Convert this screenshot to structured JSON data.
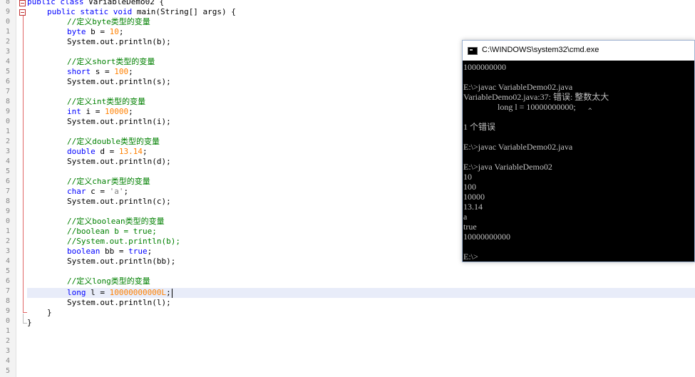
{
  "line_numbers": [
    "8",
    "9",
    "0",
    "1",
    "2",
    "3",
    "4",
    "5",
    "6",
    "7",
    "8",
    "9",
    "0",
    "1",
    "2",
    "3",
    "4",
    "5",
    "6",
    "7",
    "8",
    "9",
    "0",
    "1",
    "2",
    "3",
    "4",
    "5",
    "6",
    "7",
    "8",
    "9",
    "0",
    "1",
    "2",
    "3",
    "4",
    "5"
  ],
  "code": {
    "class_decl": {
      "kw": "public class",
      "rest": " VariableDemo02 {"
    },
    "main_decl": {
      "kw": "public static void",
      "rest": " main(String[] args) {"
    },
    "byte_comment": "//定义byte类型的变量",
    "byte_decl": {
      "kw": "byte",
      "mid": " b = ",
      "num": "10",
      "end": ";"
    },
    "byte_print": "System.out.println(b);",
    "short_comment": "//定义short类型的变量",
    "short_decl": {
      "kw": "short",
      "mid": " s = ",
      "num": "100",
      "end": ";"
    },
    "short_print": "System.out.println(s);",
    "int_comment": "//定义int类型的变量",
    "int_decl": {
      "kw": "int",
      "mid": " i = ",
      "num": "10000",
      "end": ";"
    },
    "int_print": "System.out.println(i);",
    "double_comment": "//定义double类型的变量",
    "double_decl": {
      "kw": "double",
      "mid": " d = ",
      "num": "13.14",
      "end": ";"
    },
    "double_print": "System.out.println(d);",
    "char_comment": "//定义char类型的变量",
    "char_decl": {
      "kw": "char",
      "mid": " c = ",
      "str": "'a'",
      "end": ";"
    },
    "char_print": "System.out.println(c);",
    "boolean_comment": "//定义boolean类型的变量",
    "boolean_old_decl": "//boolean b = true;",
    "boolean_old_print": "//System.out.println(b);",
    "boolean_decl": {
      "kw": "boolean",
      "mid": " bb = ",
      "kw2": "true",
      "end": ";"
    },
    "boolean_print": "System.out.println(bb);",
    "long_comment": "//定义long类型的变量",
    "long_decl": {
      "kw": "long",
      "mid": " l = ",
      "num": "10000000000L",
      "end": ";"
    },
    "long_print": "System.out.println(l);",
    "close_main": "}",
    "close_class": "}"
  },
  "cmd": {
    "title": "C:\\WINDOWS\\system32\\cmd.exe",
    "lines": [
      "1000000000",
      "",
      "E:\\>javac VariableDemo02.java",
      "VariableDemo02.java:37: 错误: 整数太大",
      "                long l = 10000000000;",
      "",
      "1 个错误",
      "",
      "E:\\>javac VariableDemo02.java",
      "",
      "E:\\>java VariableDemo02",
      "10",
      "100",
      "10000",
      "13.14",
      "a",
      "true",
      "10000000000",
      "",
      "E:\\>"
    ],
    "caret_mark": "^"
  },
  "colors": {
    "keyword": "#0000ff",
    "number": "#ff8000",
    "comment": "#008000",
    "fold_marker": "#e06666"
  }
}
